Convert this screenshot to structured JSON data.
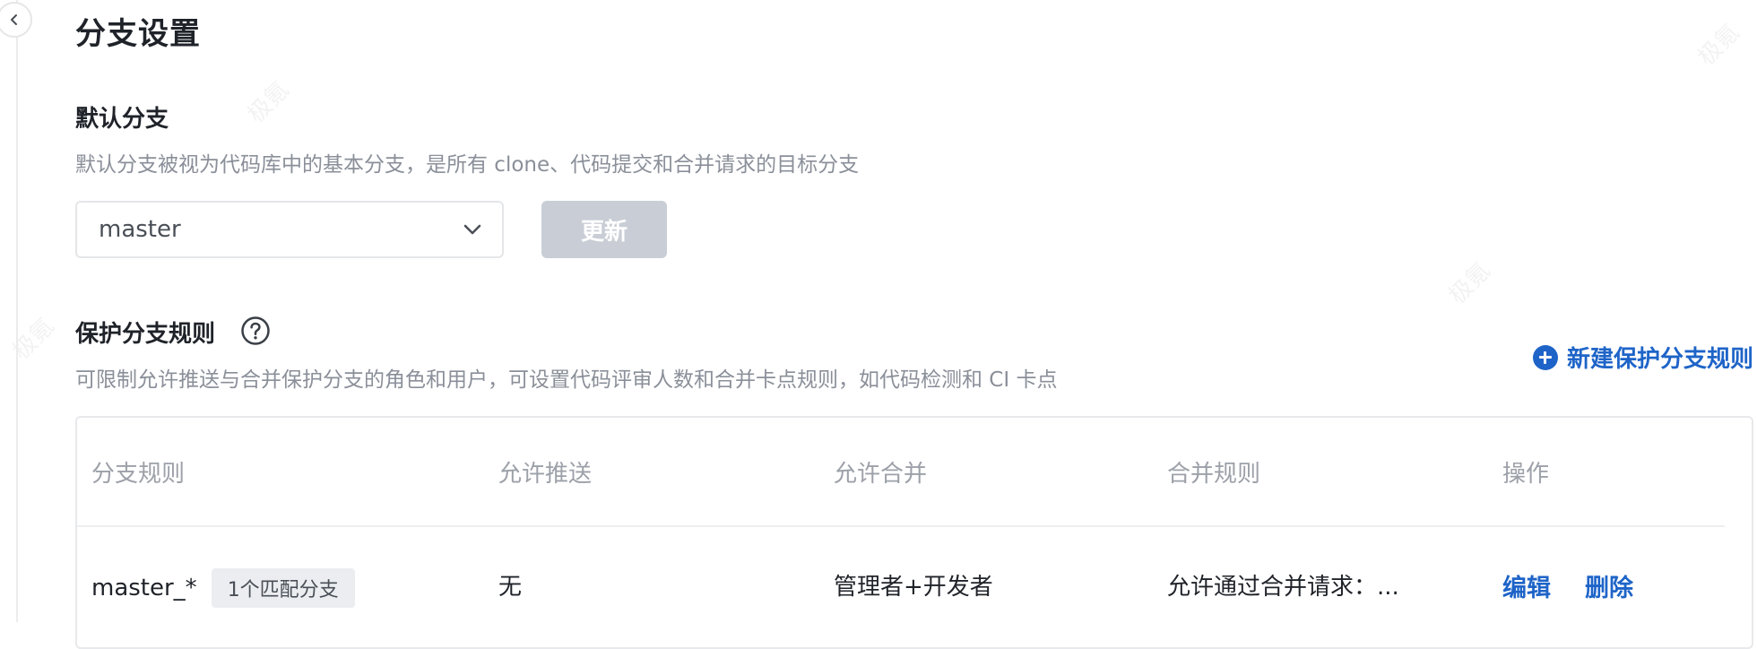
{
  "page": {
    "title": "分支设置"
  },
  "default_branch": {
    "title": "默认分支",
    "description": "默认分支被视为代码库中的基本分支，是所有 clone、代码提交和合并请求的目标分支",
    "selected": "master",
    "update_label": "更新"
  },
  "protected": {
    "title": "保护分支规则",
    "description": "可限制允许推送与合并保护分支的角色和用户，可设置代码评审人数和合并卡点规则，如代码检测和 CI 卡点",
    "new_label": "新建保护分支规则",
    "columns": [
      "分支规则",
      "允许推送",
      "允许合并",
      "合并规则",
      "操作"
    ],
    "rows": [
      {
        "rule": "master_*",
        "badge": "1个匹配分支",
        "push": "无",
        "merge": "管理者+开发者",
        "merge_rule": "允许通过合并请求：...",
        "edit": "编辑",
        "delete": "删除"
      }
    ]
  },
  "watermark": "极氪",
  "colors": {
    "link": "#1e64c8",
    "disabled_button": "#c9ced6",
    "muted_text": "#8a8f99"
  }
}
